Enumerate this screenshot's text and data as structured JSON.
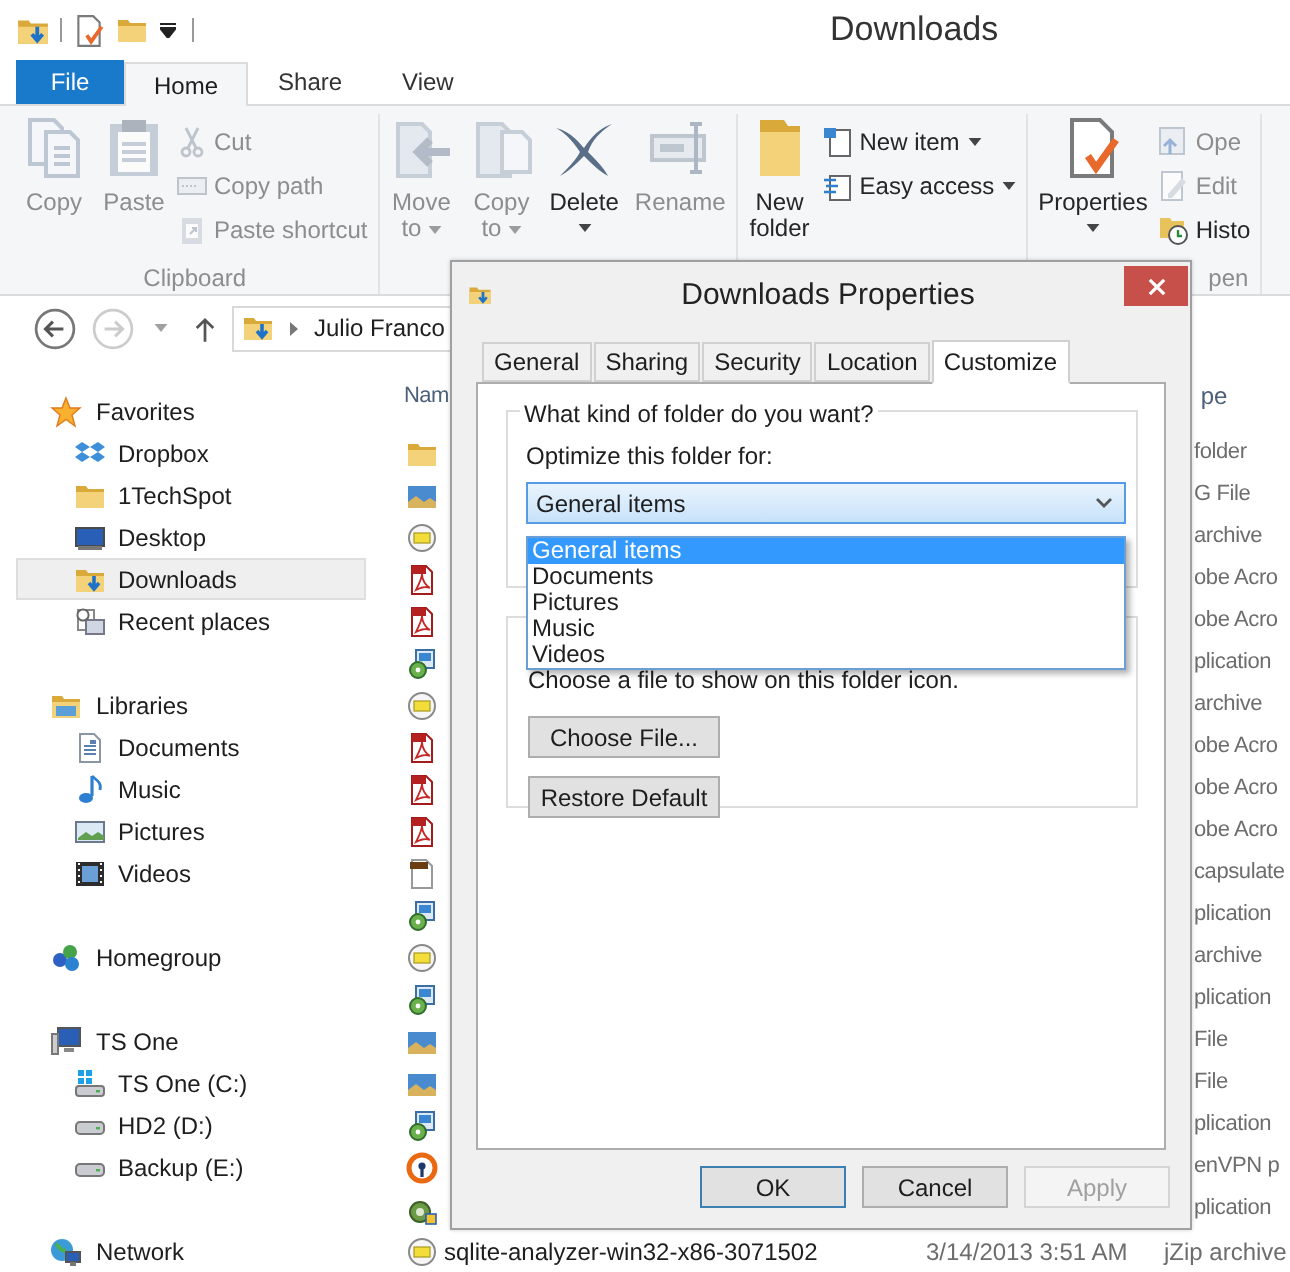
{
  "title_bar": {
    "title": "Downloads"
  },
  "ribbon": {
    "tabs": [
      {
        "label": "File",
        "kind": "file",
        "selected": false
      },
      {
        "label": "Home",
        "kind": "tab",
        "selected": true
      },
      {
        "label": "Share",
        "kind": "tab",
        "selected": false
      },
      {
        "label": "View",
        "kind": "tab",
        "selected": false
      }
    ],
    "groups": [
      {
        "label": "Clipboard",
        "columns": [
          {
            "kind": "large",
            "items": [
              {
                "lines": [
                  "Copy"
                ],
                "disabled": true,
                "dropdown": false
              }
            ]
          },
          {
            "kind": "large",
            "items": [
              {
                "lines": [
                  "Paste"
                ],
                "disabled": true,
                "dropdown": false
              }
            ]
          },
          {
            "kind": "stack",
            "items": [
              {
                "label": "Cut",
                "disabled": true,
                "dropdown": false
              },
              {
                "label": "Copy path",
                "disabled": true,
                "dropdown": false
              },
              {
                "label": "Paste shortcut",
                "disabled": true,
                "dropdown": false
              }
            ]
          }
        ]
      },
      {
        "columns": [
          {
            "kind": "large",
            "items": [
              {
                "lines": [
                  "Move",
                  "to"
                ],
                "disabled": true,
                "dropdown": true
              }
            ]
          },
          {
            "kind": "large",
            "items": [
              {
                "lines": [
                  "Copy",
                  "to"
                ],
                "disabled": true,
                "dropdown": true
              }
            ]
          },
          {
            "kind": "large",
            "items": [
              {
                "lines": [
                  "Delete"
                ],
                "disabled": false,
                "dropdown": true
              }
            ]
          },
          {
            "kind": "large",
            "items": [
              {
                "lines": [
                  "Rename"
                ],
                "disabled": true,
                "dropdown": false
              }
            ]
          }
        ]
      },
      {
        "columns": [
          {
            "kind": "large",
            "items": [
              {
                "lines": [
                  "New",
                  "folder"
                ],
                "disabled": false,
                "dropdown": false
              }
            ]
          },
          {
            "kind": "stack",
            "items": [
              {
                "label": "New item",
                "disabled": false,
                "dropdown": true
              },
              {
                "label": "Easy access",
                "disabled": false,
                "dropdown": true
              }
            ]
          }
        ]
      },
      {
        "label": "pen",
        "columns": [
          {
            "kind": "large",
            "items": [
              {
                "lines": [
                  "Properties"
                ],
                "disabled": false,
                "dropdown": true
              }
            ]
          },
          {
            "kind": "stack",
            "items": [
              {
                "label": "Ope",
                "disabled": true,
                "dropdown": false
              },
              {
                "label": "Edit",
                "disabled": true,
                "dropdown": false
              },
              {
                "label": "Histo",
                "disabled": false,
                "dropdown": false
              }
            ]
          }
        ]
      }
    ]
  },
  "address_bar": {
    "back_enabled": true,
    "forward_enabled": false,
    "path": [
      "Julio Franco"
    ]
  },
  "nav_pane": [
    {
      "label": "Favorites",
      "selected": false,
      "children": [
        {
          "label": "Dropbox",
          "selected": false
        },
        {
          "label": "1TechSpot",
          "selected": false
        },
        {
          "label": "Desktop",
          "selected": false
        },
        {
          "label": "Downloads",
          "selected": true
        },
        {
          "label": "Recent places",
          "selected": false
        }
      ]
    },
    {
      "label": "Libraries",
      "selected": false,
      "children": [
        {
          "label": "Documents",
          "selected": false
        },
        {
          "label": "Music",
          "selected": false
        },
        {
          "label": "Pictures",
          "selected": false
        },
        {
          "label": "Videos",
          "selected": false
        }
      ]
    },
    {
      "label": "Homegroup",
      "selected": false
    },
    {
      "label": "TS One",
      "selected": false,
      "children": [
        {
          "label": "TS One (C:)",
          "selected": false
        },
        {
          "label": "HD2 (D:)",
          "selected": false
        },
        {
          "label": "Backup (E:)",
          "selected": false
        }
      ]
    },
    {
      "label": "Network",
      "selected": false
    }
  ],
  "file_list": {
    "columns": [
      "Nam",
      "pe"
    ],
    "rows": [
      {
        "kind": "folder",
        "type": "folder"
      },
      {
        "kind": "image",
        "type": "G File"
      },
      {
        "kind": "archive",
        "type": "archive"
      },
      {
        "kind": "pdf",
        "type": "obe Acro"
      },
      {
        "kind": "pdf",
        "type": "obe Acro"
      },
      {
        "kind": "installer",
        "type": "plication"
      },
      {
        "kind": "archive",
        "type": "archive"
      },
      {
        "kind": "pdf",
        "type": "obe Acro"
      },
      {
        "kind": "pdf",
        "type": "obe Acro"
      },
      {
        "kind": "pdf",
        "type": "obe Acro"
      },
      {
        "kind": "document",
        "type": "capsulate"
      },
      {
        "kind": "installer",
        "type": "plication"
      },
      {
        "kind": "archive",
        "type": "archive"
      },
      {
        "kind": "installer",
        "type": "plication"
      },
      {
        "kind": "image",
        "type": "File"
      },
      {
        "kind": "image",
        "type": "File"
      },
      {
        "kind": "installer",
        "type": "plication"
      },
      {
        "kind": "vpn",
        "type": "enVPN p"
      },
      {
        "kind": "setup",
        "type": "plication"
      },
      {
        "kind": "archive",
        "name": "sqlite-analyzer-win32-x86-3071502",
        "date": "3/14/2013 3:51 AM",
        "type": "jZip archive"
      }
    ]
  },
  "dialog": {
    "title": "Downloads Properties",
    "tabs": [
      {
        "label": "General",
        "selected": false
      },
      {
        "label": "Sharing",
        "selected": false
      },
      {
        "label": "Security",
        "selected": false
      },
      {
        "label": "Location",
        "selected": false
      },
      {
        "label": "Customize",
        "selected": true
      }
    ],
    "folder_type_group": {
      "legend": "What kind of folder do you want?",
      "label": "Optimize this folder for:",
      "dropdown": {
        "value": "General items",
        "expanded": true,
        "options": [
          {
            "label": "General items",
            "selected": true
          },
          {
            "label": "Documents",
            "selected": false
          },
          {
            "label": "Pictures",
            "selected": false
          },
          {
            "label": "Music",
            "selected": false
          },
          {
            "label": "Videos",
            "selected": false
          }
        ]
      }
    },
    "folder_icon_group": {
      "text": "Choose a file to show on this folder icon.",
      "buttons": [
        "Choose File...",
        "Restore Default"
      ]
    },
    "buttons": [
      {
        "label": "OK",
        "default": true,
        "disabled": false
      },
      {
        "label": "Cancel",
        "default": false,
        "disabled": false
      },
      {
        "label": "Apply",
        "default": false,
        "disabled": true
      }
    ]
  }
}
